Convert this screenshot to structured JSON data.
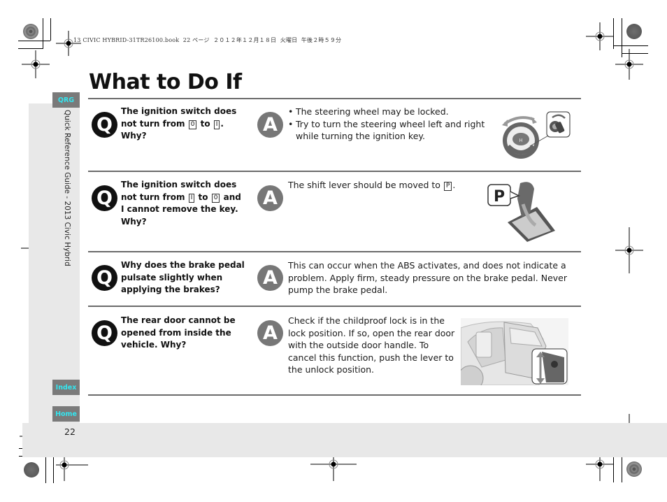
{
  "print_header": "13 CIVIC HYBRID-31TR26100.book  22 ページ  ２０１２年１２月１８日  火曜日  午後２時５９分",
  "page_title": "What to Do If",
  "sidebar": {
    "tab_qrg": "QRG",
    "vertical_label": "Quick Reference Guide - 2013 Civic Hybrid",
    "tab_index": "Index",
    "tab_home": "Home"
  },
  "page_number": "22",
  "colors": {
    "accent_tab_text": "#33e6f0",
    "tab_bg": "#7a7a7a",
    "panel_bg": "#e8e8e8",
    "rule": "#6b6b6b",
    "q_badge": "#111111",
    "a_badge": "#777777"
  },
  "badges": {
    "question": "Q",
    "answer": "A"
  },
  "faq": [
    {
      "question": {
        "line1": "The ignition switch does",
        "line2_pre": "not turn from ",
        "key1": "0",
        "line2_mid": " to ",
        "key2": "I",
        "line2_post": ".",
        "line3": "Why?"
      },
      "answer": {
        "bullets": [
          "The steering wheel may be locked.",
          "Try to turn the steering wheel left and right while turning the ignition key."
        ]
      },
      "illustration": "steering-wheel-and-ignition-key"
    },
    {
      "question": {
        "line1": "The ignition switch does",
        "line2_pre": "not turn from ",
        "key1": "I",
        "line2_mid": " to ",
        "key2": "0",
        "line2_post": " and",
        "line3": "I cannot remove the key.",
        "line4": "Why?"
      },
      "answer": {
        "text_pre": "The shift lever should be moved to ",
        "key": "P",
        "text_post": "."
      },
      "illustration": "shift-lever-park",
      "illustration_label": "P"
    },
    {
      "question": {
        "text": "Why does the brake pedal pulsate slightly when applying the brakes?"
      },
      "answer": {
        "text": "This can occur when the ABS activates, and does not indicate a problem. Apply firm, steady pressure on the brake pedal. Never pump the brake pedal."
      }
    },
    {
      "question": {
        "text": "The rear door cannot be opened from inside the vehicle. Why?"
      },
      "answer": {
        "text": "Check if the childproof lock is in the lock position. If so, open the rear door with the outside door handle. To cancel this function, push the lever to the unlock position."
      },
      "illustration": "rear-door-childproof-lock"
    }
  ]
}
